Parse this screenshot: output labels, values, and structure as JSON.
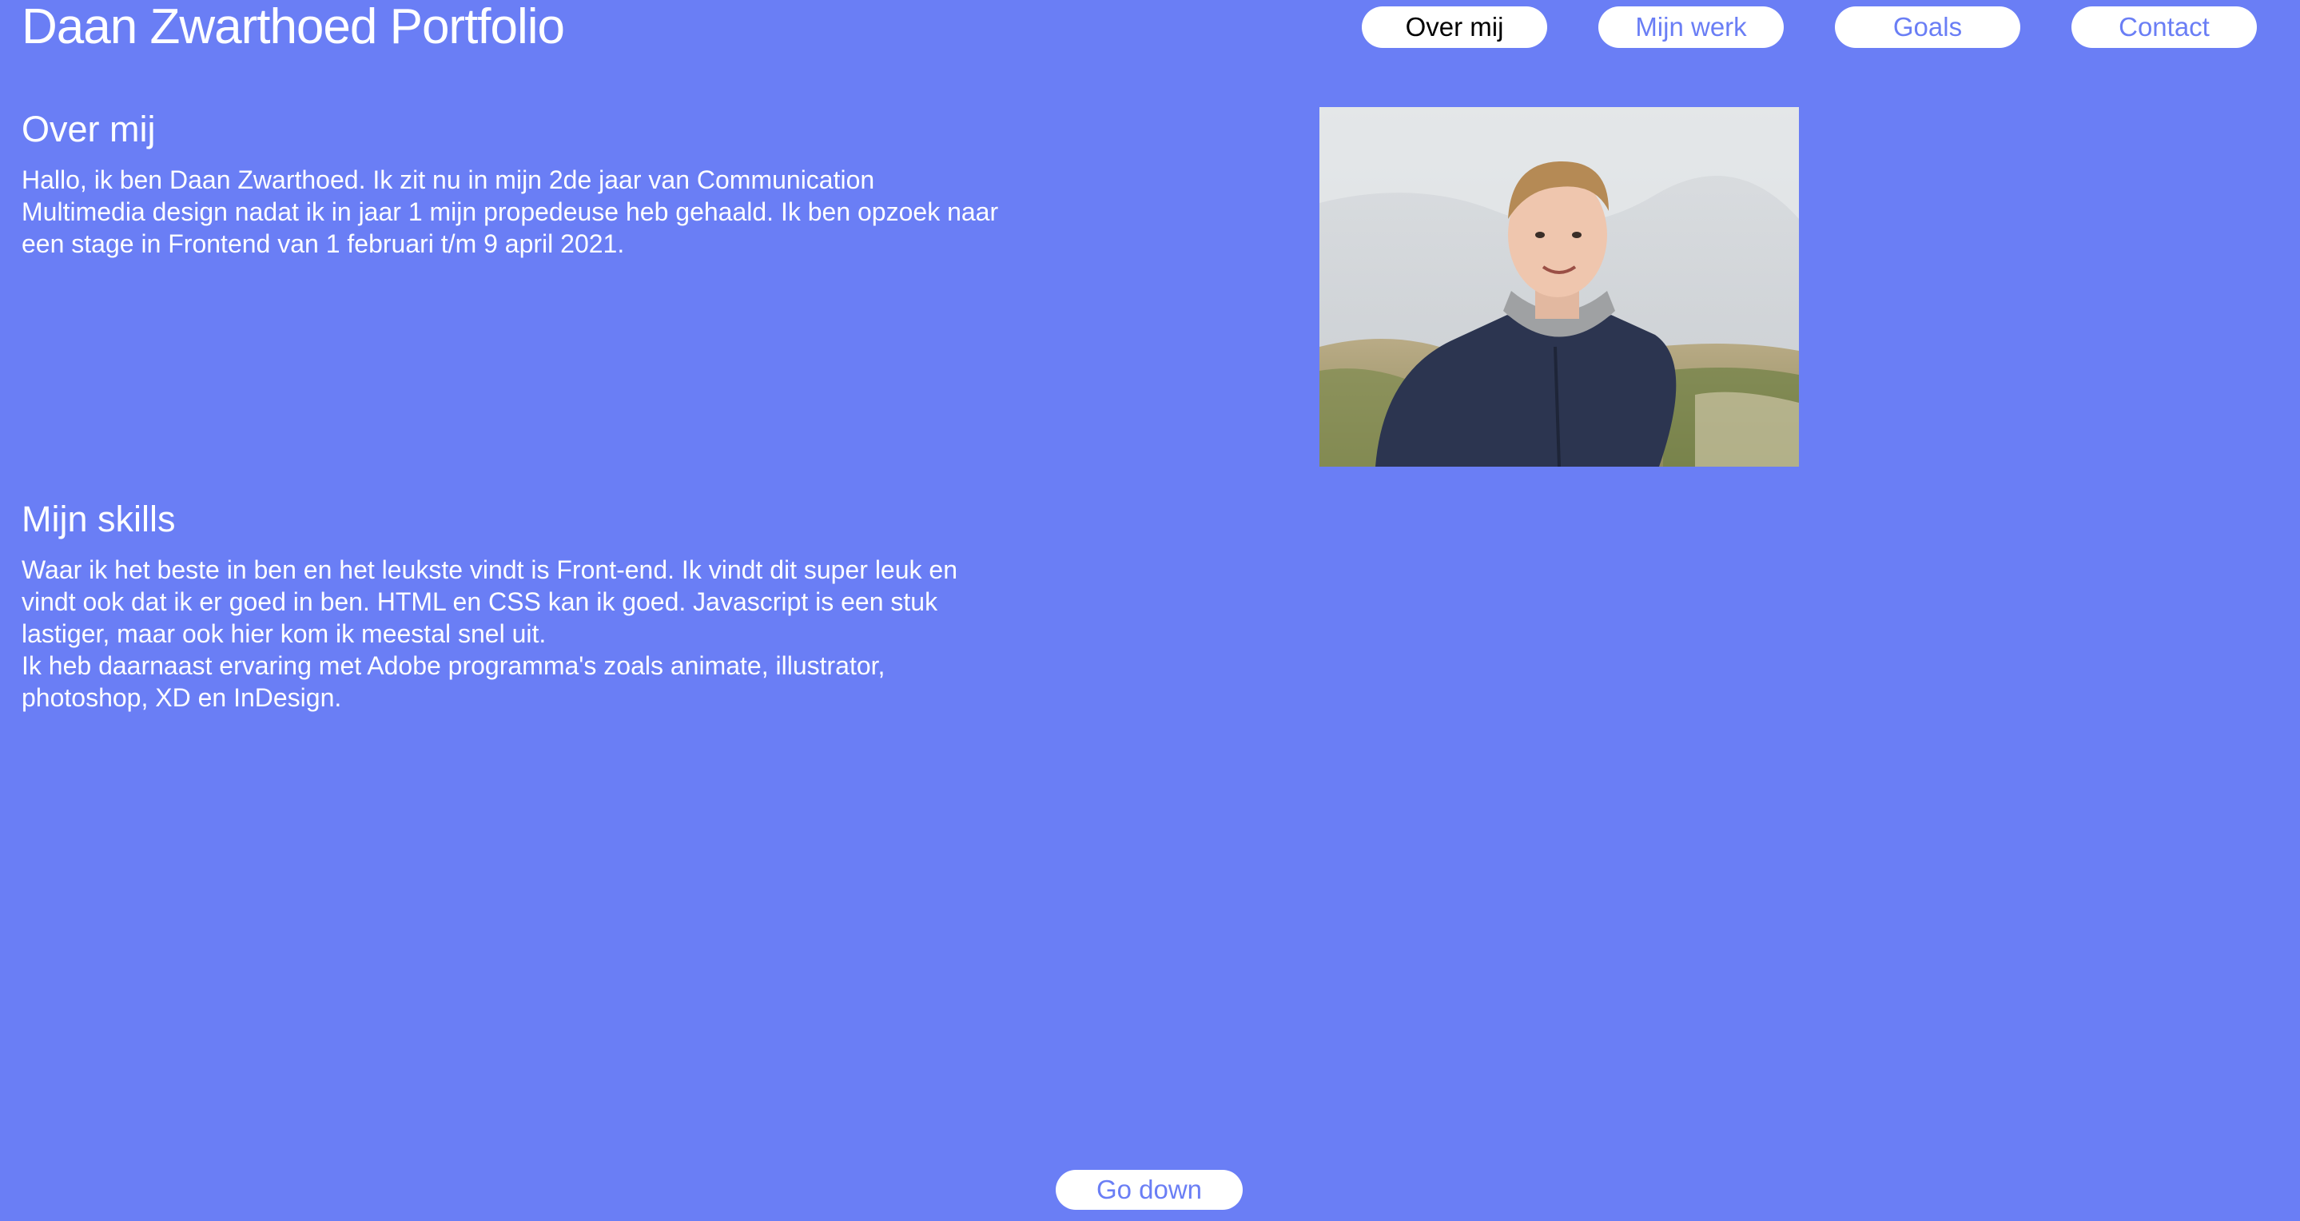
{
  "header": {
    "title": "Daan Zwarthoed Portfolio",
    "nav": [
      {
        "label": "Over mij",
        "active": true
      },
      {
        "label": "Mijn werk",
        "active": false
      },
      {
        "label": "Goals",
        "active": false
      },
      {
        "label": "Contact",
        "active": false
      }
    ]
  },
  "about": {
    "heading": "Over mij",
    "text": "Hallo, ik ben Daan Zwarthoed. Ik zit nu in mijn 2de jaar van Communication Multimedia design nadat ik in jaar 1 mijn propedeuse heb gehaald. Ik ben opzoek naar een stage in Frontend van 1 februari t/m 9 april 2021."
  },
  "skills": {
    "heading": "Mijn skills",
    "text": "Waar ik het beste in ben en het leukste vindt is Front-end. Ik vindt dit super leuk en vindt ook dat ik er goed in ben. HTML en CSS kan ik goed. Javascript is een stuk lastiger, maar ook hier kom ik meestal snel uit.\nIk heb daarnaast ervaring met Adobe programma's zoals animate, illustrator, photoshop, XD en InDesign."
  },
  "footer": {
    "go_down_label": "Go down"
  },
  "colors": {
    "background": "#6a7ef5",
    "button_bg": "#ffffff",
    "button_text": "#6a7ef5",
    "active_text": "#000000"
  }
}
